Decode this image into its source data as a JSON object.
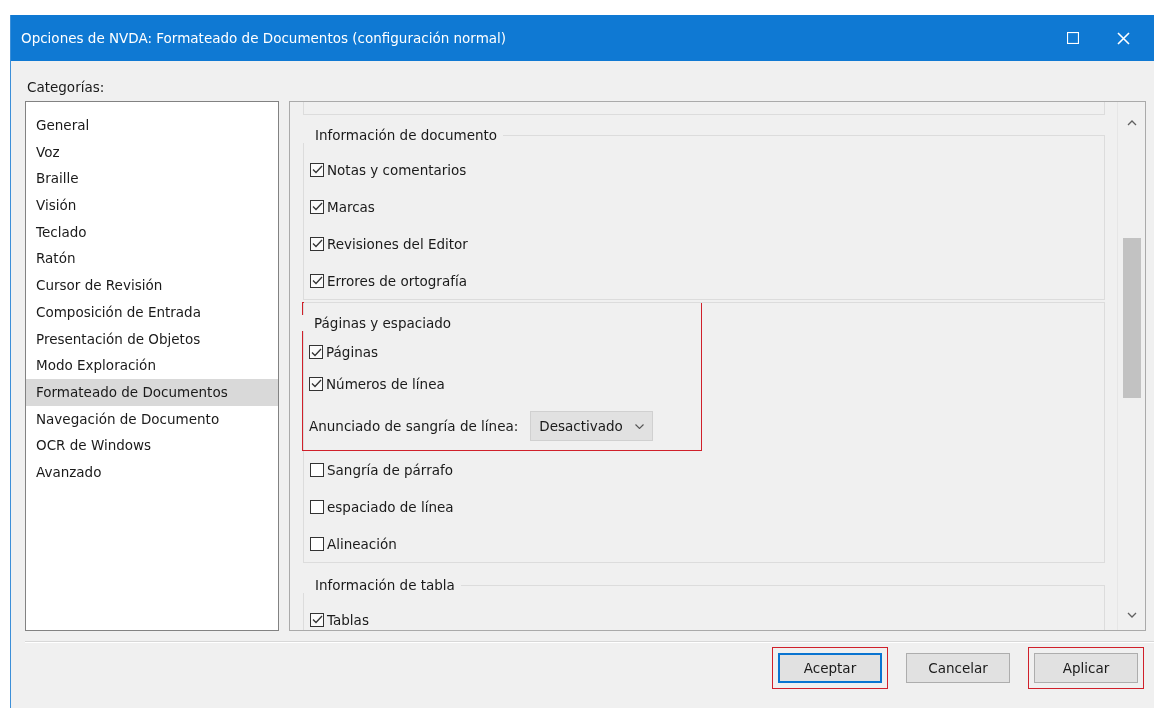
{
  "window": {
    "title": "Opciones de NVDA: Formateado de Documentos (configuración normal)"
  },
  "categories_label": "Categorías:",
  "categories": [
    {
      "label": "General",
      "selected": false
    },
    {
      "label": "Voz",
      "selected": false
    },
    {
      "label": "Braille",
      "selected": false
    },
    {
      "label": "Visión",
      "selected": false
    },
    {
      "label": "Teclado",
      "selected": false
    },
    {
      "label": "Ratón",
      "selected": false
    },
    {
      "label": "Cursor de Revisión",
      "selected": false
    },
    {
      "label": "Composición de Entrada",
      "selected": false
    },
    {
      "label": "Presentación de Objetos",
      "selected": false
    },
    {
      "label": "Modo Exploración",
      "selected": false
    },
    {
      "label": "Formateado de Documentos",
      "selected": true
    },
    {
      "label": "Navegación de Documento",
      "selected": false
    },
    {
      "label": "OCR de Windows",
      "selected": false
    },
    {
      "label": "Avanzado",
      "selected": false
    }
  ],
  "groups": [
    {
      "title": "Información de documento",
      "highlighted": false,
      "items": [
        {
          "kind": "checkbox",
          "label": "Notas y comentarios",
          "checked": true
        },
        {
          "kind": "checkbox",
          "label": "Marcas",
          "checked": true
        },
        {
          "kind": "checkbox",
          "label": "Revisiones del Editor",
          "checked": true
        },
        {
          "kind": "checkbox",
          "label": "Errores de ortografía",
          "checked": true
        }
      ]
    },
    {
      "title": "Páginas y espaciado",
      "highlighted": true,
      "items": [
        {
          "kind": "checkbox",
          "label": "Páginas",
          "checked": true
        },
        {
          "kind": "checkbox",
          "label": "Números de línea",
          "checked": true
        },
        {
          "kind": "combo",
          "label": "Anunciado de sangría de línea:",
          "value": "Desactivado"
        },
        {
          "kind": "checkbox",
          "label": "Sangría de párrafo",
          "checked": false
        },
        {
          "kind": "checkbox",
          "label": "espaciado de línea",
          "checked": false
        },
        {
          "kind": "checkbox",
          "label": "Alineación",
          "checked": false
        }
      ]
    },
    {
      "title": "Información de tabla",
      "highlighted": false,
      "items": [
        {
          "kind": "checkbox",
          "label": "Tablas",
          "checked": true
        }
      ]
    }
  ],
  "buttons": [
    {
      "label": "Aceptar",
      "default": true,
      "highlighted": true
    },
    {
      "label": "Cancelar",
      "default": false,
      "highlighted": false
    },
    {
      "label": "Aplicar",
      "default": false,
      "highlighted": true
    }
  ]
}
